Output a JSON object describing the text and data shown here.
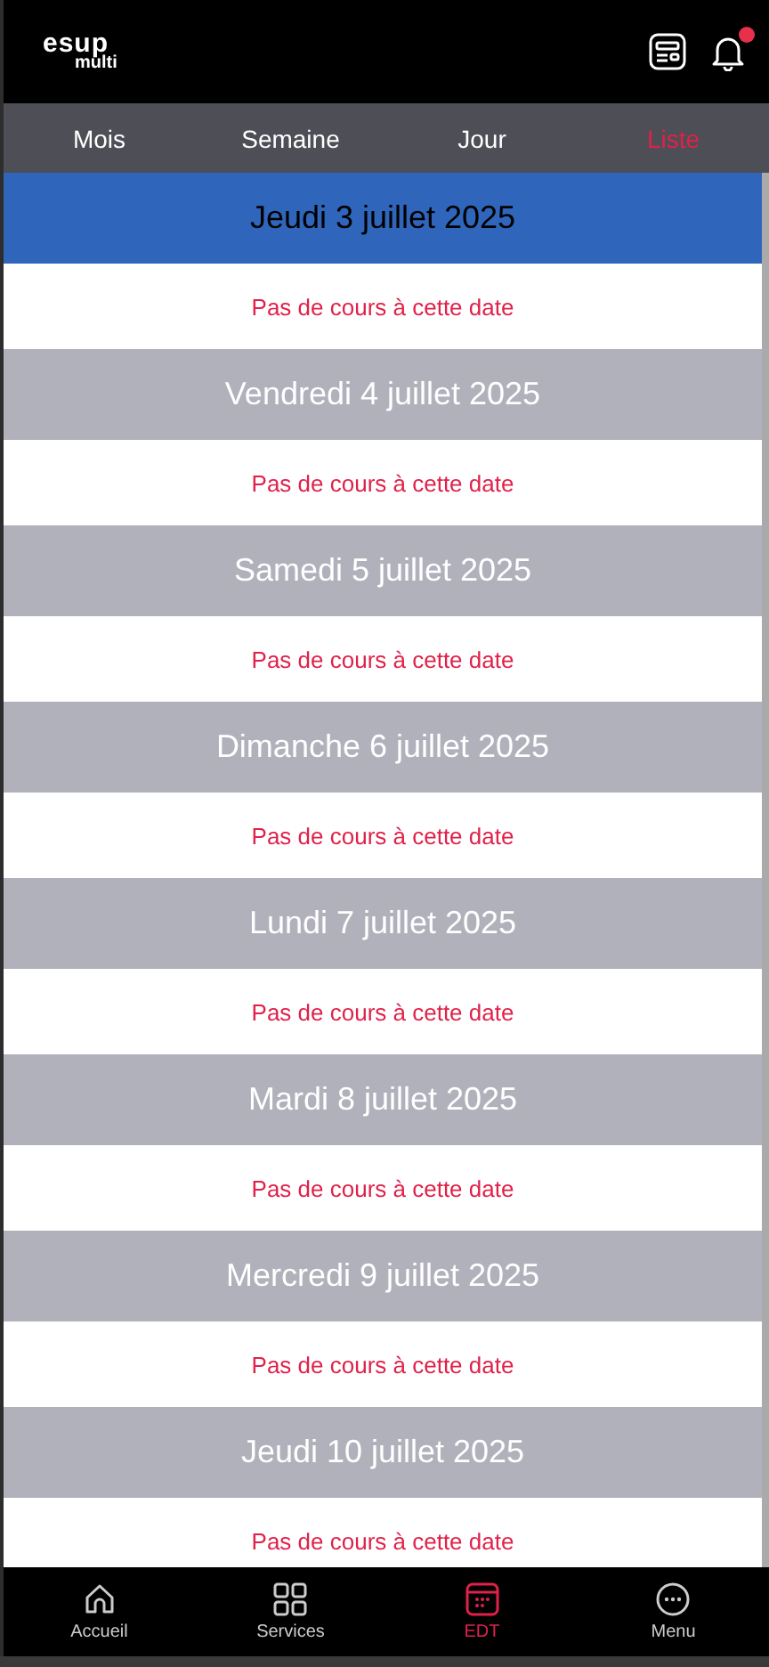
{
  "logo": {
    "top": "esup",
    "bottom": "multi"
  },
  "header": {
    "notification": true
  },
  "tabs": [
    {
      "label": "Mois",
      "selected": false
    },
    {
      "label": "Semaine",
      "selected": false
    },
    {
      "label": "Jour",
      "selected": false
    },
    {
      "label": "Liste",
      "selected": true
    }
  ],
  "days": [
    {
      "title": "Jeudi 3 juillet 2025",
      "selected": true,
      "message": "Pas de cours à cette date"
    },
    {
      "title": "Vendredi 4 juillet 2025",
      "selected": false,
      "message": "Pas de cours à cette date"
    },
    {
      "title": "Samedi 5 juillet 2025",
      "selected": false,
      "message": "Pas de cours à cette date"
    },
    {
      "title": "Dimanche 6 juillet 2025",
      "selected": false,
      "message": "Pas de cours à cette date"
    },
    {
      "title": "Lundi 7 juillet 2025",
      "selected": false,
      "message": "Pas de cours à cette date"
    },
    {
      "title": "Mardi 8 juillet 2025",
      "selected": false,
      "message": "Pas de cours à cette date"
    },
    {
      "title": "Mercredi 9 juillet 2025",
      "selected": false,
      "message": "Pas de cours à cette date"
    },
    {
      "title": "Jeudi 10 juillet 2025",
      "selected": false,
      "message": "Pas de cours à cette date"
    }
  ],
  "nav": [
    {
      "kind": "home",
      "label": "Accueil",
      "selected": false
    },
    {
      "kind": "grid",
      "label": "Services",
      "selected": false
    },
    {
      "kind": "calendar",
      "label": "EDT",
      "selected": true
    },
    {
      "kind": "more",
      "label": "Menu",
      "selected": false
    }
  ]
}
